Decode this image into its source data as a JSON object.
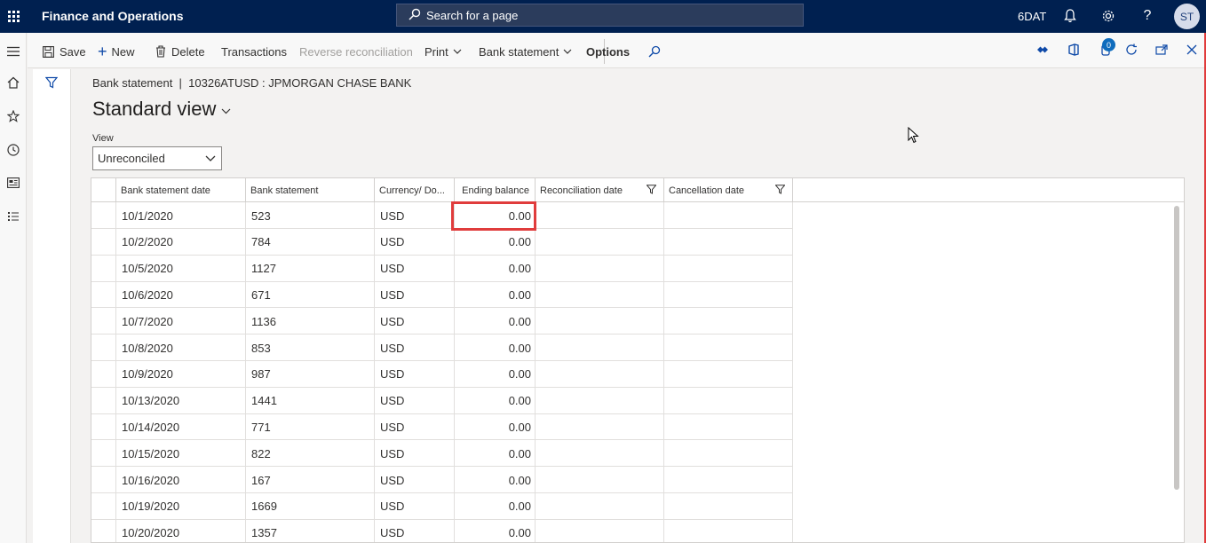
{
  "app": {
    "title": "Finance and Operations",
    "search_placeholder": "Search for a page",
    "company": "6DAT",
    "user_initials": "ST"
  },
  "actions": {
    "save": "Save",
    "new": "New",
    "delete": "Delete",
    "transactions": "Transactions",
    "reverse_reconciliation": "Reverse reconciliation",
    "print": "Print",
    "bank_statement": "Bank statement",
    "options": "Options",
    "notification_count": "0"
  },
  "page": {
    "breadcrumb": "Bank statement  |  10326ATUSD : JPMORGAN CHASE BANK",
    "title": "Standard view",
    "view_label": "View",
    "view_value": "Unreconciled"
  },
  "grid": {
    "columns": [
      "Bank statement date",
      "Bank statement",
      "Currency/ Do...",
      "Ending balance",
      "Reconciliation date",
      "Cancellation date"
    ],
    "rows": [
      {
        "date": "10/1/2020",
        "statement": "523",
        "currency": "USD",
        "balance": "0.00"
      },
      {
        "date": "10/2/2020",
        "statement": "784",
        "currency": "USD",
        "balance": "0.00"
      },
      {
        "date": "10/5/2020",
        "statement": "1127",
        "currency": "USD",
        "balance": "0.00"
      },
      {
        "date": "10/6/2020",
        "statement": "671",
        "currency": "USD",
        "balance": "0.00"
      },
      {
        "date": "10/7/2020",
        "statement": "1136",
        "currency": "USD",
        "balance": "0.00"
      },
      {
        "date": "10/8/2020",
        "statement": "853",
        "currency": "USD",
        "balance": "0.00"
      },
      {
        "date": "10/9/2020",
        "statement": "987",
        "currency": "USD",
        "balance": "0.00"
      },
      {
        "date": "10/13/2020",
        "statement": "1441",
        "currency": "USD",
        "balance": "0.00"
      },
      {
        "date": "10/14/2020",
        "statement": "771",
        "currency": "USD",
        "balance": "0.00"
      },
      {
        "date": "10/15/2020",
        "statement": "822",
        "currency": "USD",
        "balance": "0.00"
      },
      {
        "date": "10/16/2020",
        "statement": "167",
        "currency": "USD",
        "balance": "0.00"
      },
      {
        "date": "10/19/2020",
        "statement": "1669",
        "currency": "USD",
        "balance": "0.00"
      },
      {
        "date": "10/20/2020",
        "statement": "1357",
        "currency": "USD",
        "balance": "0.00"
      }
    ]
  },
  "colors": {
    "topbar": "#002050",
    "highlight": "#e03c3c",
    "accent": "#0f4aa8"
  }
}
